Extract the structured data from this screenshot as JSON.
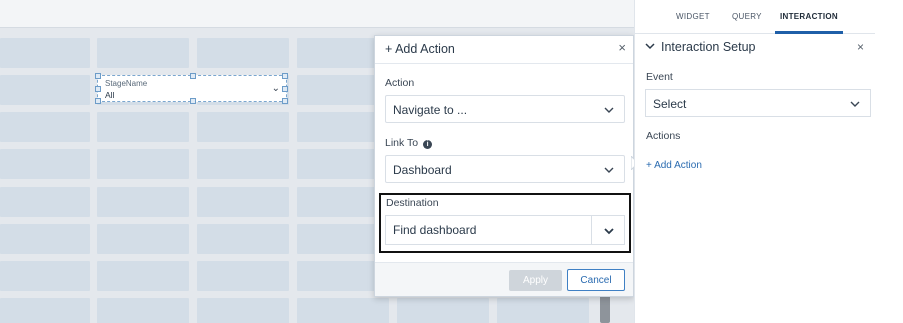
{
  "canvas": {
    "widget": {
      "label": "StageName",
      "value": "All"
    }
  },
  "popover": {
    "title": "+ Add Action",
    "close": "×",
    "action": {
      "label": "Action",
      "value": "Navigate to ..."
    },
    "link_to": {
      "label": "Link To",
      "info": "i",
      "value": "Dashboard"
    },
    "destination": {
      "label": "Destination",
      "value": "Find dashboard"
    },
    "apply_label": "Apply",
    "cancel_label": "Cancel"
  },
  "right_panel": {
    "tabs": [
      {
        "label": "WIDGET",
        "active": false
      },
      {
        "label": "QUERY",
        "active": false
      },
      {
        "label": "INTERACTION",
        "active": true
      }
    ],
    "header": "Interaction Setup",
    "close": "×",
    "event": {
      "label": "Event",
      "value": "Select"
    },
    "actions_label": "Actions",
    "add_action_link": "+ Add Action"
  },
  "colors": {
    "accent": "#1f5fa8",
    "link": "#2a6bb0",
    "canvas_bg": "#e4e8ed",
    "grid_cell": "#d3dde7",
    "highlight_border": "#111111"
  }
}
